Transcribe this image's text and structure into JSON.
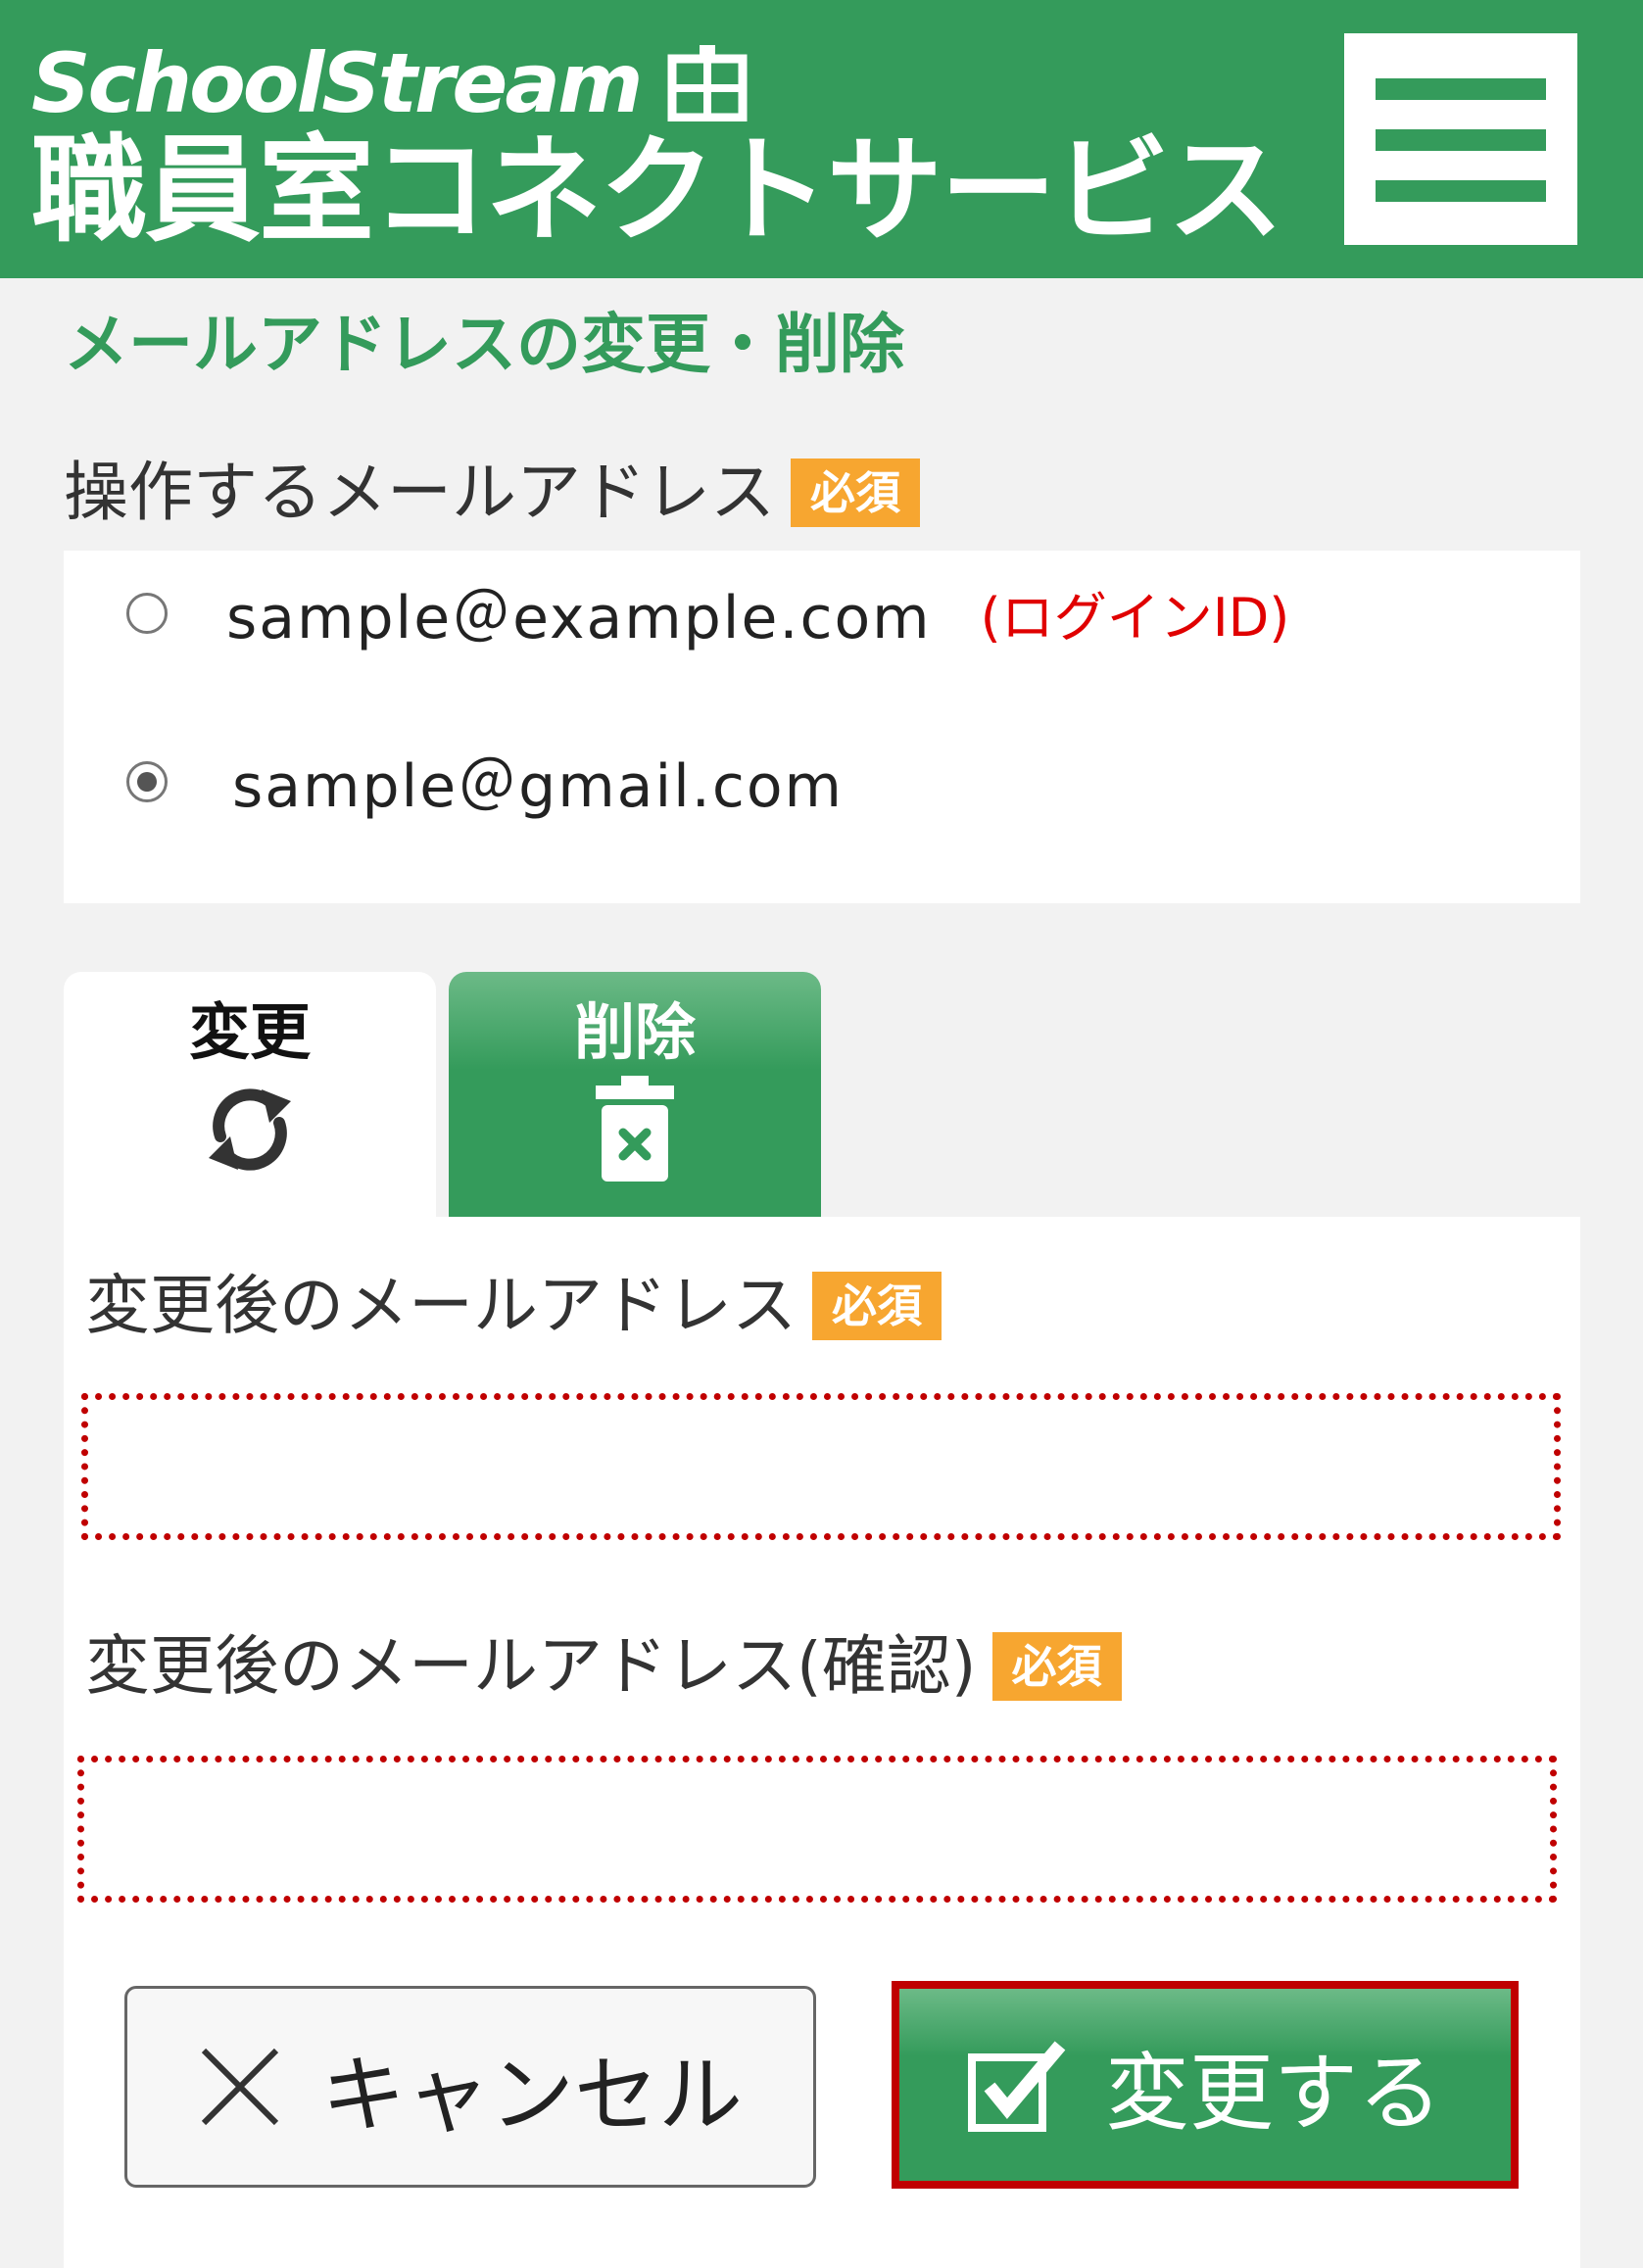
{
  "header": {
    "brand": "SchoolStream",
    "service": "職員室コネクトサービス",
    "menu_icon": "hamburger-menu-icon"
  },
  "page": {
    "title": "メールアドレスの変更・削除"
  },
  "target_email": {
    "label": "操作するメールアドレス",
    "required_badge": "必須",
    "options": [
      {
        "email": "sample＠example.com",
        "tag": "(ログインID)",
        "selected": false
      },
      {
        "email": "sample＠gmail.com",
        "tag": "",
        "selected": true
      }
    ]
  },
  "tabs": [
    {
      "label": "変更",
      "icon": "refresh-icon",
      "active": true
    },
    {
      "label": "削除",
      "icon": "trash-icon",
      "active": false
    }
  ],
  "form": {
    "new_email": {
      "label": "変更後のメールアドレス",
      "required_badge": "必須",
      "value": "",
      "placeholder": ""
    },
    "confirm_email": {
      "label": "変更後のメールアドレス(確認)",
      "required_badge": "必須",
      "value": "",
      "placeholder": ""
    }
  },
  "buttons": {
    "cancel": {
      "label": "キャンセル",
      "icon": "close-icon"
    },
    "submit": {
      "label": "変更する",
      "icon": "checkbox-checked-icon"
    }
  },
  "colors": {
    "brand_green": "#349b5b",
    "badge_orange": "#f7a630",
    "highlight_red": "#c00000",
    "login_tag_red": "#e00000"
  }
}
